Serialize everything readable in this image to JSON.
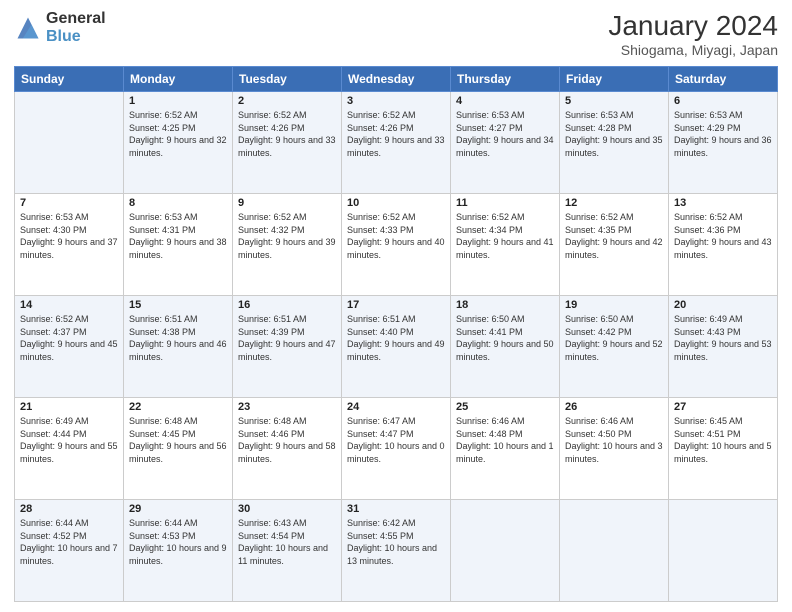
{
  "header": {
    "logo_line1": "General",
    "logo_line2": "Blue",
    "month_year": "January 2024",
    "location": "Shiogama, Miyagi, Japan"
  },
  "days_of_week": [
    "Sunday",
    "Monday",
    "Tuesday",
    "Wednesday",
    "Thursday",
    "Friday",
    "Saturday"
  ],
  "weeks": [
    [
      {
        "day": "",
        "sunrise": "",
        "sunset": "",
        "daylight": ""
      },
      {
        "day": "1",
        "sunrise": "Sunrise: 6:52 AM",
        "sunset": "Sunset: 4:25 PM",
        "daylight": "Daylight: 9 hours and 32 minutes."
      },
      {
        "day": "2",
        "sunrise": "Sunrise: 6:52 AM",
        "sunset": "Sunset: 4:26 PM",
        "daylight": "Daylight: 9 hours and 33 minutes."
      },
      {
        "day": "3",
        "sunrise": "Sunrise: 6:52 AM",
        "sunset": "Sunset: 4:26 PM",
        "daylight": "Daylight: 9 hours and 33 minutes."
      },
      {
        "day": "4",
        "sunrise": "Sunrise: 6:53 AM",
        "sunset": "Sunset: 4:27 PM",
        "daylight": "Daylight: 9 hours and 34 minutes."
      },
      {
        "day": "5",
        "sunrise": "Sunrise: 6:53 AM",
        "sunset": "Sunset: 4:28 PM",
        "daylight": "Daylight: 9 hours and 35 minutes."
      },
      {
        "day": "6",
        "sunrise": "Sunrise: 6:53 AM",
        "sunset": "Sunset: 4:29 PM",
        "daylight": "Daylight: 9 hours and 36 minutes."
      }
    ],
    [
      {
        "day": "7",
        "sunrise": "Sunrise: 6:53 AM",
        "sunset": "Sunset: 4:30 PM",
        "daylight": "Daylight: 9 hours and 37 minutes."
      },
      {
        "day": "8",
        "sunrise": "Sunrise: 6:53 AM",
        "sunset": "Sunset: 4:31 PM",
        "daylight": "Daylight: 9 hours and 38 minutes."
      },
      {
        "day": "9",
        "sunrise": "Sunrise: 6:52 AM",
        "sunset": "Sunset: 4:32 PM",
        "daylight": "Daylight: 9 hours and 39 minutes."
      },
      {
        "day": "10",
        "sunrise": "Sunrise: 6:52 AM",
        "sunset": "Sunset: 4:33 PM",
        "daylight": "Daylight: 9 hours and 40 minutes."
      },
      {
        "day": "11",
        "sunrise": "Sunrise: 6:52 AM",
        "sunset": "Sunset: 4:34 PM",
        "daylight": "Daylight: 9 hours and 41 minutes."
      },
      {
        "day": "12",
        "sunrise": "Sunrise: 6:52 AM",
        "sunset": "Sunset: 4:35 PM",
        "daylight": "Daylight: 9 hours and 42 minutes."
      },
      {
        "day": "13",
        "sunrise": "Sunrise: 6:52 AM",
        "sunset": "Sunset: 4:36 PM",
        "daylight": "Daylight: 9 hours and 43 minutes."
      }
    ],
    [
      {
        "day": "14",
        "sunrise": "Sunrise: 6:52 AM",
        "sunset": "Sunset: 4:37 PM",
        "daylight": "Daylight: 9 hours and 45 minutes."
      },
      {
        "day": "15",
        "sunrise": "Sunrise: 6:51 AM",
        "sunset": "Sunset: 4:38 PM",
        "daylight": "Daylight: 9 hours and 46 minutes."
      },
      {
        "day": "16",
        "sunrise": "Sunrise: 6:51 AM",
        "sunset": "Sunset: 4:39 PM",
        "daylight": "Daylight: 9 hours and 47 minutes."
      },
      {
        "day": "17",
        "sunrise": "Sunrise: 6:51 AM",
        "sunset": "Sunset: 4:40 PM",
        "daylight": "Daylight: 9 hours and 49 minutes."
      },
      {
        "day": "18",
        "sunrise": "Sunrise: 6:50 AM",
        "sunset": "Sunset: 4:41 PM",
        "daylight": "Daylight: 9 hours and 50 minutes."
      },
      {
        "day": "19",
        "sunrise": "Sunrise: 6:50 AM",
        "sunset": "Sunset: 4:42 PM",
        "daylight": "Daylight: 9 hours and 52 minutes."
      },
      {
        "day": "20",
        "sunrise": "Sunrise: 6:49 AM",
        "sunset": "Sunset: 4:43 PM",
        "daylight": "Daylight: 9 hours and 53 minutes."
      }
    ],
    [
      {
        "day": "21",
        "sunrise": "Sunrise: 6:49 AM",
        "sunset": "Sunset: 4:44 PM",
        "daylight": "Daylight: 9 hours and 55 minutes."
      },
      {
        "day": "22",
        "sunrise": "Sunrise: 6:48 AM",
        "sunset": "Sunset: 4:45 PM",
        "daylight": "Daylight: 9 hours and 56 minutes."
      },
      {
        "day": "23",
        "sunrise": "Sunrise: 6:48 AM",
        "sunset": "Sunset: 4:46 PM",
        "daylight": "Daylight: 9 hours and 58 minutes."
      },
      {
        "day": "24",
        "sunrise": "Sunrise: 6:47 AM",
        "sunset": "Sunset: 4:47 PM",
        "daylight": "Daylight: 10 hours and 0 minutes."
      },
      {
        "day": "25",
        "sunrise": "Sunrise: 6:46 AM",
        "sunset": "Sunset: 4:48 PM",
        "daylight": "Daylight: 10 hours and 1 minute."
      },
      {
        "day": "26",
        "sunrise": "Sunrise: 6:46 AM",
        "sunset": "Sunset: 4:50 PM",
        "daylight": "Daylight: 10 hours and 3 minutes."
      },
      {
        "day": "27",
        "sunrise": "Sunrise: 6:45 AM",
        "sunset": "Sunset: 4:51 PM",
        "daylight": "Daylight: 10 hours and 5 minutes."
      }
    ],
    [
      {
        "day": "28",
        "sunrise": "Sunrise: 6:44 AM",
        "sunset": "Sunset: 4:52 PM",
        "daylight": "Daylight: 10 hours and 7 minutes."
      },
      {
        "day": "29",
        "sunrise": "Sunrise: 6:44 AM",
        "sunset": "Sunset: 4:53 PM",
        "daylight": "Daylight: 10 hours and 9 minutes."
      },
      {
        "day": "30",
        "sunrise": "Sunrise: 6:43 AM",
        "sunset": "Sunset: 4:54 PM",
        "daylight": "Daylight: 10 hours and 11 minutes."
      },
      {
        "day": "31",
        "sunrise": "Sunrise: 6:42 AM",
        "sunset": "Sunset: 4:55 PM",
        "daylight": "Daylight: 10 hours and 13 minutes."
      },
      {
        "day": "",
        "sunrise": "",
        "sunset": "",
        "daylight": ""
      },
      {
        "day": "",
        "sunrise": "",
        "sunset": "",
        "daylight": ""
      },
      {
        "day": "",
        "sunrise": "",
        "sunset": "",
        "daylight": ""
      }
    ]
  ]
}
